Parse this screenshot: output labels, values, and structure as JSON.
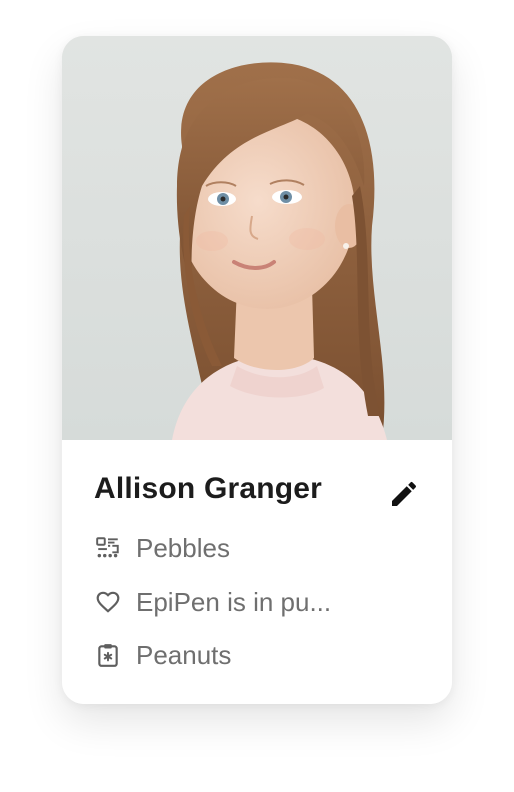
{
  "profile": {
    "name": "Allison Granger",
    "photo_icon": "child-portrait-photo",
    "edit_icon": "pencil-edit-icon"
  },
  "details": [
    {
      "icon": "group-class-icon",
      "label": "Pebbles"
    },
    {
      "icon": "heart-icon",
      "label": "EpiPen is in pu..."
    },
    {
      "icon": "medical-clipboard-icon",
      "label": "Peanuts"
    }
  ],
  "colors": {
    "name_text": "#1c1c1c",
    "detail_text": "#6f6f6f",
    "icon": "#5f5f5f",
    "photo_background": "#dfe3e2"
  }
}
